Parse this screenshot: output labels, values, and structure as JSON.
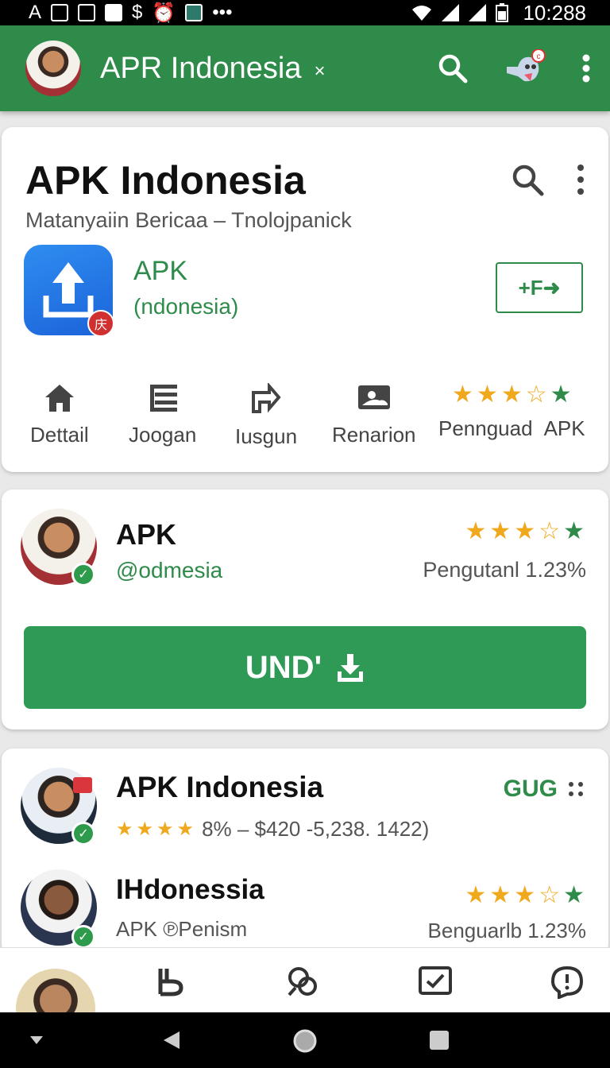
{
  "status_bar": {
    "left_text": "A",
    "time": "10:288"
  },
  "app_bar": {
    "title": "APR Indonesia",
    "close_glyph": "×",
    "actions": [
      "search-icon",
      "notification-icon",
      "more-vert-icon"
    ]
  },
  "app_card": {
    "title": "APK Indonesia",
    "subtitle": "Matanyaiin Bericaa  –  Tnolojpanick",
    "app_name": "APK",
    "developer": "(ndonesia)",
    "icon_badge": "庆",
    "action_button": "+F➜",
    "tabs": [
      {
        "label": "Dettail",
        "icon": "home-icon"
      },
      {
        "label": "Joogan",
        "icon": "list-icon"
      },
      {
        "label": "Iusgun",
        "icon": "share-icon"
      },
      {
        "label": "Renarion",
        "icon": "gallery-icon"
      },
      {
        "label": "Pennguad",
        "icon": "rating-stars"
      },
      {
        "label": "APK",
        "icon": "rating-stars"
      }
    ],
    "rating_stars": 3.5
  },
  "publisher_card": {
    "name": "APK",
    "handle": "@odmesia",
    "rating_stars": 3.5,
    "stat": "Pengutanl  1.23%",
    "install_label": "UND'"
  },
  "list_card": {
    "items": [
      {
        "name": "APK Indonesia",
        "meta": "8% – $420 -5,238. 1422)",
        "tag": "GUG",
        "rating_stars": 3.5
      },
      {
        "name": "IHdonessia",
        "sub": "APK ℗Penism",
        "stat": "Benguarlb 1.23%",
        "rating_stars": 3.5
      }
    ]
  },
  "bottom_nav": {
    "items": [
      "profile-avatar",
      "bookmark-icon",
      "discover-icon",
      "tasks-icon",
      "alerts-icon"
    ]
  },
  "colors": {
    "brand_green": "#2e8b4a",
    "install_green": "#2e9a55",
    "star_gold": "#f0a81c",
    "app_icon_blue": "#1f6fe0"
  }
}
